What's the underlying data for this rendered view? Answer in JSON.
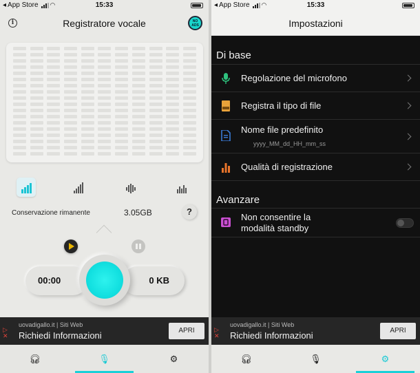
{
  "status_bar": {
    "carrier": "App Store",
    "time": "15:33"
  },
  "recorder": {
    "title": "Registratore vocale",
    "no_ads_badge": "NO ADS",
    "storage_label": "Conservazione rimanente",
    "storage_value": "3.05GB",
    "help": "?",
    "elapsed_time": "00:00",
    "file_size": "0 KB",
    "modes": [
      "level-bars-icon",
      "signal-bars-icon",
      "waveform-icon",
      "spectrum-icon"
    ],
    "accent_color": "#19d6cc"
  },
  "settings": {
    "title": "Impostazioni",
    "section_basic": "Di base",
    "items": [
      {
        "label": "Regolazione del microfono",
        "icon": "microphone-icon",
        "color": "#2ec27e"
      },
      {
        "label": "Registra il tipo di file",
        "icon": "file-type-icon",
        "color": "#e8a23a"
      },
      {
        "label": "Nome file predefinito",
        "sublabel": "yyyy_MM_dd_HH_mm_ss",
        "icon": "document-icon",
        "color": "#3a7bd5"
      },
      {
        "label": "Qualità di registrazione",
        "icon": "bar-chart-icon",
        "color": "#e8742a"
      }
    ],
    "section_advanced": "Avanzare",
    "standby_label_line1": "Non consentire la",
    "standby_label_line2": "modalità standby",
    "standby_enabled": false
  },
  "ad": {
    "site": "uovadigallo.it | Siti Web",
    "headline": "Richiedi Informazioni",
    "button": "APRI"
  }
}
